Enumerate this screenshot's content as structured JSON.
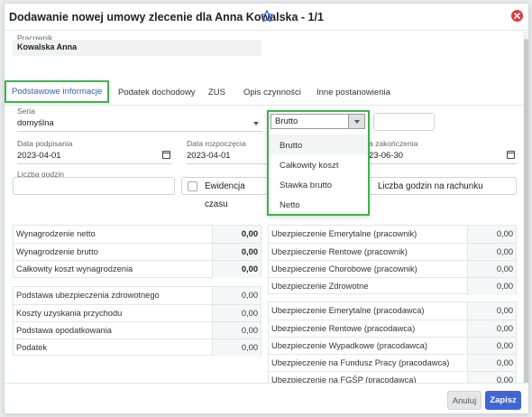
{
  "header": {
    "title": "Dodawanie nowej umowy zlecenie dla Anna Kowalska - 1/1"
  },
  "employee": {
    "label": "Pracownik",
    "value": "Kowalska Anna"
  },
  "tabs": [
    {
      "label": "Podstawowe informacje"
    },
    {
      "label": "Podatek dochodowy"
    },
    {
      "label": "ZUS"
    },
    {
      "label": "Opis czynności"
    },
    {
      "label": "Inne postanowienia"
    }
  ],
  "form": {
    "series_label": "Seria",
    "series_value": "domyślna",
    "amount_type": "Brutto",
    "date_sign_label": "Data podpisania",
    "date_sign": "2023-04-01",
    "date_start_label": "Data rozpoczęcia",
    "date_start": "2023-04-01",
    "date_end_label": "a zakończenia",
    "date_end": "23-06-30",
    "hours_label": "Liczba godzin",
    "time_record_label": "Ewidencja czasu",
    "invoice_hours_label": "Liczba godzin na rachunku"
  },
  "dropdown": {
    "selected": "Brutto",
    "options": [
      "Brutto",
      "Całkowity koszt",
      "Stawka brutto",
      "Netto"
    ]
  },
  "left_table_1": [
    {
      "label": "Wynagrodzenie netto",
      "value": "0,00"
    },
    {
      "label": "Wynagrodzenie brutto",
      "value": "0,00"
    },
    {
      "label": "Całkowity koszt wynagrodzenia",
      "value": "0,00"
    }
  ],
  "left_table_2": [
    {
      "label": "Podstawa ubezpieczenia zdrowotnego",
      "value": "0,00"
    },
    {
      "label": "Koszty uzyskania przychodu",
      "value": "0,00"
    },
    {
      "label": "Podstawa opodatkowania",
      "value": "0,00"
    },
    {
      "label": "Podatek",
      "value": "0,00"
    }
  ],
  "right_table_1": [
    {
      "label": "Ubezpieczenie Emerytalne (pracownik)",
      "value": "0,00"
    },
    {
      "label": "Ubezpieczenie Rentowe (pracownik)",
      "value": "0,00"
    },
    {
      "label": "Ubezpieczenie Chorobowe (pracownik)",
      "value": "0,00"
    },
    {
      "label": "Ubezpieczenie Zdrowotne",
      "value": "0,00"
    }
  ],
  "right_table_2": [
    {
      "label": "Ubezpieczenie Emerytalne (pracodawca)",
      "value": "0,00"
    },
    {
      "label": "Ubezpieczenie Rentowe (pracodawca)",
      "value": "0,00"
    },
    {
      "label": "Ubezpieczenie Wypadkowe (pracodawca)",
      "value": "0,00"
    },
    {
      "label": "Ubezpieczenie na Fundusz Pracy (pracodawca)",
      "value": "0,00"
    },
    {
      "label": "Ubezpieczenie na FGŚP (pracodawca)",
      "value": "0,00"
    }
  ],
  "footer": {
    "cancel_label": "Anuluj",
    "save_label": "Zapisz"
  },
  "colors": {
    "accent": "#3d66d6",
    "highlight": "#3cb34a",
    "close": "#e0393e"
  },
  "icons": {
    "star": "star-icon",
    "close": "close-icon",
    "calendar": "calendar-icon",
    "caret": "chevron-down-icon"
  }
}
